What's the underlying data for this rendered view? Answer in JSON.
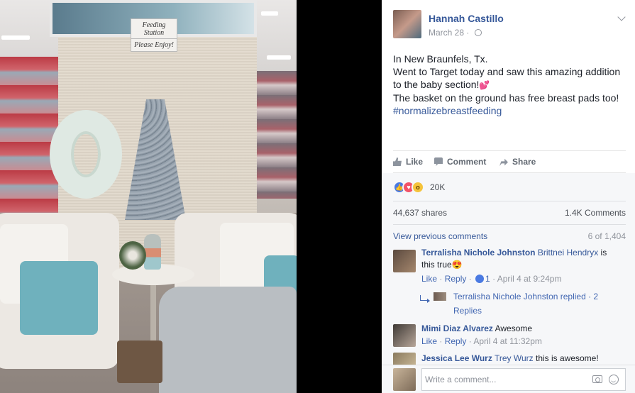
{
  "photo": {
    "sign_top": "Feeding Station",
    "sign_bottom": "Please Enjoy!"
  },
  "post": {
    "author": "Hannah Castillo",
    "date": "March 28 · ",
    "text_lines": [
      "In New Braunfels, Tx.",
      "Went to Target today and saw this amazing addition",
      "to the baby section!",
      "The basket on the ground has free breast pads too!"
    ],
    "emoji": "💕",
    "hashtag": "#normalizebreastfeeding"
  },
  "actions": {
    "like": "Like",
    "comment": "Comment",
    "share": "Share"
  },
  "reactions": {
    "icons": [
      "like",
      "love",
      "wow"
    ],
    "count": "20K"
  },
  "stats": {
    "shares": "44,637 shares",
    "comments": "1.4K Comments"
  },
  "comments_section": {
    "view_previous": "View previous comments",
    "count": "6 of 1,404"
  },
  "comments": [
    {
      "name": "Terralisha Nichole Johnston",
      "tag": "Brittnei Hendryx",
      "text_after_tag": " is",
      "text_line2": "this true",
      "emoji": "😍",
      "like": "Like",
      "reply": "Reply",
      "reaction_count": "1",
      "time": "April 4 at 9:24pm",
      "replies_link": "Terralisha Nichole Johnston replied · 2",
      "replies_link_line2": "Replies"
    },
    {
      "name": "Mimi Diaz Alvarez",
      "text": "Awesome",
      "like": "Like",
      "reply": "Reply",
      "time": "April 4 at 11:32pm"
    },
    {
      "name": "Jessica Lee Wurz",
      "tag": "Trey Wurz",
      "text": "this is awesome!"
    }
  ],
  "composer": {
    "placeholder": "Write a comment..."
  }
}
